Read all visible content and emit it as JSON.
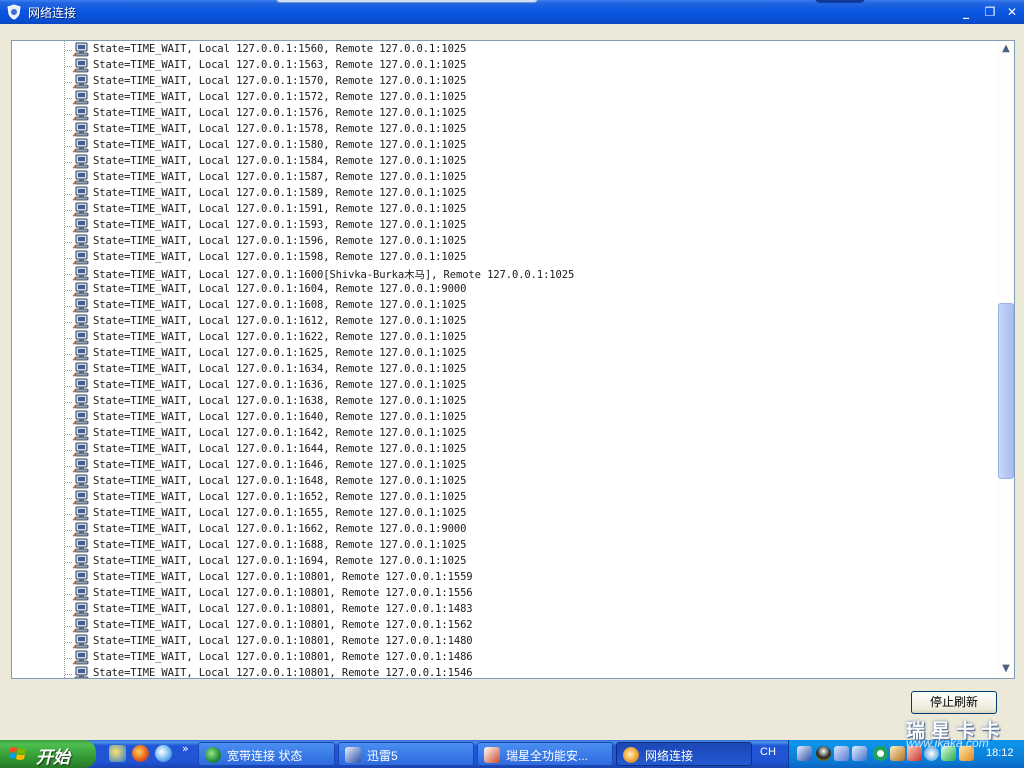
{
  "window": {
    "title": "网络连接"
  },
  "tree": {
    "rows": [
      "State=TIME_WAIT, Local 127.0.0.1:1560, Remote 127.0.0.1:1025",
      "State=TIME_WAIT, Local 127.0.0.1:1563, Remote 127.0.0.1:1025",
      "State=TIME_WAIT, Local 127.0.0.1:1570, Remote 127.0.0.1:1025",
      "State=TIME_WAIT, Local 127.0.0.1:1572, Remote 127.0.0.1:1025",
      "State=TIME_WAIT, Local 127.0.0.1:1576, Remote 127.0.0.1:1025",
      "State=TIME_WAIT, Local 127.0.0.1:1578, Remote 127.0.0.1:1025",
      "State=TIME_WAIT, Local 127.0.0.1:1580, Remote 127.0.0.1:1025",
      "State=TIME_WAIT, Local 127.0.0.1:1584, Remote 127.0.0.1:1025",
      "State=TIME_WAIT, Local 127.0.0.1:1587, Remote 127.0.0.1:1025",
      "State=TIME_WAIT, Local 127.0.0.1:1589, Remote 127.0.0.1:1025",
      "State=TIME_WAIT, Local 127.0.0.1:1591, Remote 127.0.0.1:1025",
      "State=TIME_WAIT, Local 127.0.0.1:1593, Remote 127.0.0.1:1025",
      "State=TIME_WAIT, Local 127.0.0.1:1596, Remote 127.0.0.1:1025",
      "State=TIME_WAIT, Local 127.0.0.1:1598, Remote 127.0.0.1:1025",
      "State=TIME_WAIT, Local 127.0.0.1:1600[Shivka-Burka木马], Remote 127.0.0.1:1025",
      "State=TIME_WAIT, Local 127.0.0.1:1604, Remote 127.0.0.1:9000",
      "State=TIME_WAIT, Local 127.0.0.1:1608, Remote 127.0.0.1:1025",
      "State=TIME_WAIT, Local 127.0.0.1:1612, Remote 127.0.0.1:1025",
      "State=TIME_WAIT, Local 127.0.0.1:1622, Remote 127.0.0.1:1025",
      "State=TIME_WAIT, Local 127.0.0.1:1625, Remote 127.0.0.1:1025",
      "State=TIME_WAIT, Local 127.0.0.1:1634, Remote 127.0.0.1:1025",
      "State=TIME_WAIT, Local 127.0.0.1:1636, Remote 127.0.0.1:1025",
      "State=TIME_WAIT, Local 127.0.0.1:1638, Remote 127.0.0.1:1025",
      "State=TIME_WAIT, Local 127.0.0.1:1640, Remote 127.0.0.1:1025",
      "State=TIME_WAIT, Local 127.0.0.1:1642, Remote 127.0.0.1:1025",
      "State=TIME_WAIT, Local 127.0.0.1:1644, Remote 127.0.0.1:1025",
      "State=TIME_WAIT, Local 127.0.0.1:1646, Remote 127.0.0.1:1025",
      "State=TIME_WAIT, Local 127.0.0.1:1648, Remote 127.0.0.1:1025",
      "State=TIME_WAIT, Local 127.0.0.1:1652, Remote 127.0.0.1:1025",
      "State=TIME_WAIT, Local 127.0.0.1:1655, Remote 127.0.0.1:1025",
      "State=TIME_WAIT, Local 127.0.0.1:1662, Remote 127.0.0.1:9000",
      "State=TIME_WAIT, Local 127.0.0.1:1688, Remote 127.0.0.1:1025",
      "State=TIME_WAIT, Local 127.0.0.1:1694, Remote 127.0.0.1:1025",
      "State=TIME_WAIT, Local 127.0.0.1:10801, Remote 127.0.0.1:1559",
      "State=TIME_WAIT, Local 127.0.0.1:10801, Remote 127.0.0.1:1556",
      "State=TIME_WAIT, Local 127.0.0.1:10801, Remote 127.0.0.1:1483",
      "State=TIME_WAIT, Local 127.0.0.1:10801, Remote 127.0.0.1:1562",
      "State=TIME_WAIT, Local 127.0.0.1:10801, Remote 127.0.0.1:1480",
      "State=TIME_WAIT, Local 127.0.0.1:10801, Remote 127.0.0.1:1486",
      "State=TIME_WAIT, Local 127.0.0.1:10801, Remote 127.0.0.1:1546"
    ]
  },
  "stop_button": {
    "label": "停止刷新"
  },
  "taskbar": {
    "start_label": "开始",
    "quicklaunch_more": "»",
    "tasks": [
      {
        "label": "宽带连接 状态",
        "icon": "globe-icon",
        "color": "#1f8f3a",
        "active": false
      },
      {
        "label": "迅雷5",
        "icon": "thunder-icon",
        "color": "#2b4fa8",
        "active": false
      },
      {
        "label": "瑞星全功能安...",
        "icon": "rising-shield-icon",
        "color": "#c84a2a",
        "active": false
      },
      {
        "label": "网络连接",
        "icon": "gear-icon",
        "color": "#f2a23c",
        "active": true
      }
    ],
    "language": "CH",
    "clock": "18:12"
  },
  "watermark": {
    "text": "瑞星卡卡",
    "url": "www.ikaka.com"
  },
  "colors": {
    "titlebar": "#0a56e3",
    "taskbar": "#2157d7",
    "start": "#359a35",
    "tree_text": "#1a1a1a",
    "tray": "#0b77d3"
  }
}
